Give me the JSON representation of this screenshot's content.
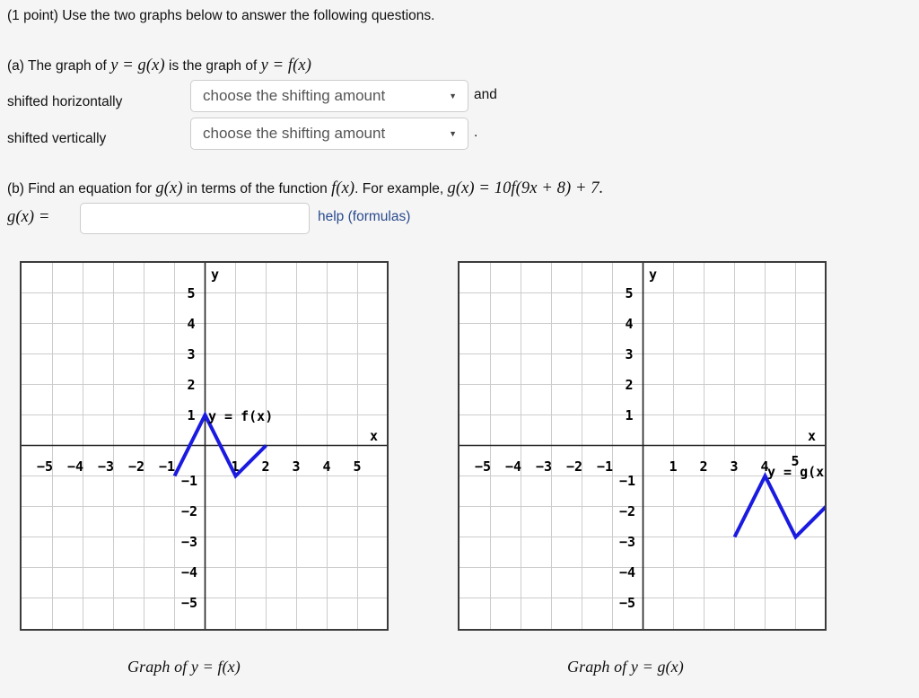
{
  "problem": {
    "points_label": "(1 point)",
    "intro": "Use the two graphs below to answer the following questions.",
    "part_a": {
      "prefix": "(a) The graph of",
      "g_of_x": "y = g(x)",
      "middle": "is the graph of",
      "f_of_x": "y = f(x)",
      "horizontal_label": "shifted horizontally",
      "vertical_label": "shifted vertically",
      "and_word": "and",
      "period": ".",
      "select_placeholder": "choose the shifting amount",
      "caret_glyph": "▼",
      "options": [
        "choose the shifting amount"
      ]
    },
    "part_b": {
      "text_1": "(b) Find an equation for",
      "g_inline": "g(x)",
      "text_2": "in terms of the function",
      "f_inline": "f(x)",
      "text_3": ". For example,",
      "example": "g(x) = 10f(9x + 8) + 7.",
      "gx_equals": "g(x) =",
      "answer_value": "",
      "answer_placeholder": "",
      "help_link": "help (formulas)"
    }
  },
  "colors": {
    "page_background": "#f5f5f5",
    "curve_blue": "#1a1ae0",
    "axis_black": "#222222",
    "grid_gray": "#cccccc",
    "link_blue": "#2a4b8d",
    "frame_border": "#3b3b3b"
  },
  "chart_data": [
    {
      "type": "line",
      "id": "graph-f",
      "title": "Graph of y = f(x)",
      "inline_label": "y = f(x)",
      "xlabel": "x",
      "ylabel": "y",
      "xlim": [
        -5.8,
        5.8
      ],
      "ylim": [
        -5.8,
        5.8
      ],
      "xticks": [
        -5,
        -4,
        -3,
        -2,
        -1,
        1,
        2,
        3,
        4,
        5
      ],
      "yticks": [
        5,
        4,
        3,
        2,
        1,
        -1,
        -2,
        -3,
        -4,
        -5
      ],
      "grid": true,
      "series": [
        {
          "name": "f(x)",
          "color": "#1a1ae0",
          "points": [
            [
              -1,
              -1
            ],
            [
              0,
              1
            ],
            [
              1,
              -1
            ],
            [
              2,
              0
            ]
          ]
        }
      ]
    },
    {
      "type": "line",
      "id": "graph-g",
      "title": "Graph of y = g(x)",
      "inline_label": "y = g(x",
      "xlabel": "x",
      "ylabel": "y",
      "xlim": [
        -5.8,
        5.8
      ],
      "ylim": [
        -5.8,
        5.8
      ],
      "xticks": [
        -5,
        -4,
        -3,
        -2,
        -1,
        1,
        2,
        3,
        4,
        5
      ],
      "yticks": [
        5,
        4,
        3,
        2,
        1,
        -1,
        -2,
        -3,
        -4,
        -5
      ],
      "grid": true,
      "series": [
        {
          "name": "g(x)",
          "color": "#1a1ae0",
          "points": [
            [
              3,
              -3
            ],
            [
              4,
              -1
            ],
            [
              5,
              -3
            ],
            [
              6,
              -2
            ]
          ]
        }
      ]
    }
  ],
  "captions": {
    "left": "Graph of y = f(x)",
    "right": "Graph of y = g(x)"
  }
}
